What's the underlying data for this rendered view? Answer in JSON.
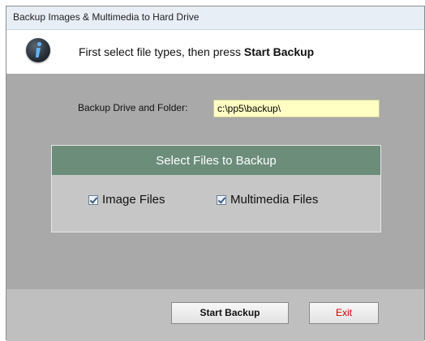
{
  "window": {
    "title": "Backup Images & Multimedia to Hard Drive"
  },
  "header": {
    "instruction_prefix": "First select file types, then press ",
    "instruction_emphasis": "Start Backup",
    "icon": "info-icon"
  },
  "folder": {
    "label": "Backup Drive and Folder:",
    "value": "c:\\pp5\\backup\\"
  },
  "file_select": {
    "title": "Select Files to Backup",
    "options": [
      {
        "label": "Image Files",
        "checked": true
      },
      {
        "label": "Multimedia Files",
        "checked": true
      }
    ]
  },
  "buttons": {
    "start": "Start Backup",
    "exit": "Exit"
  },
  "colors": {
    "panel_bg": "#a9a9a9",
    "box_header": "#6b8d7a",
    "input_bg": "#ffffc4",
    "exit_text": "#cc0000"
  }
}
